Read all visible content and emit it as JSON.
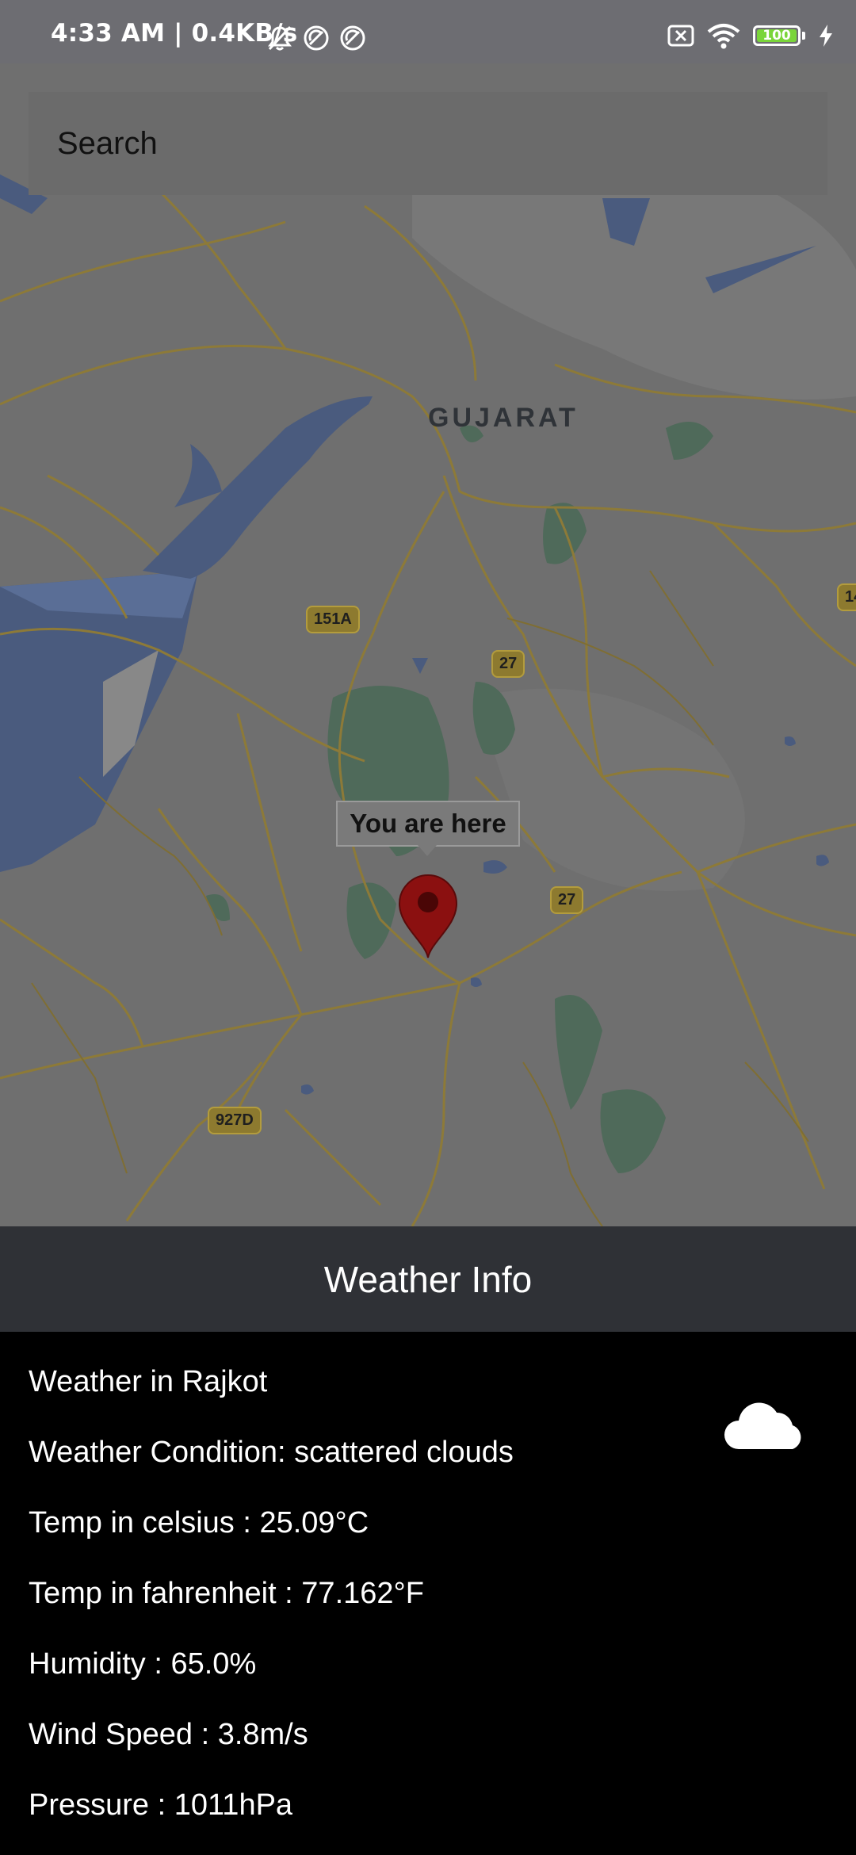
{
  "status_bar": {
    "time": "4:33 AM | 0.4KB/s",
    "battery": "100"
  },
  "search": {
    "placeholder": "Search"
  },
  "map": {
    "region_label": "GUJARAT",
    "shields": [
      "151A",
      "27",
      "27",
      "927D",
      "14"
    ],
    "marker_tooltip": "You are here"
  },
  "weather": {
    "header": "Weather Info",
    "city_line": "Weather in Rajkot",
    "condition_line": "Weather Condition: scattered clouds",
    "celsius_line": "Temp in celsius : 25.09°C",
    "fahrenheit_line": "Temp in fahrenheit : 77.162°F",
    "humidity_line": "Humidity : 65.0%",
    "wind_line": "Wind Speed : 3.8m/s",
    "pressure_line": "Pressure : 1011hPa",
    "icon": "cloud-icon"
  },
  "colors": {
    "status_bar": "#6d6d72",
    "header_bg": "#2f3136",
    "body_bg": "#000000",
    "marker": "#8b1010"
  }
}
